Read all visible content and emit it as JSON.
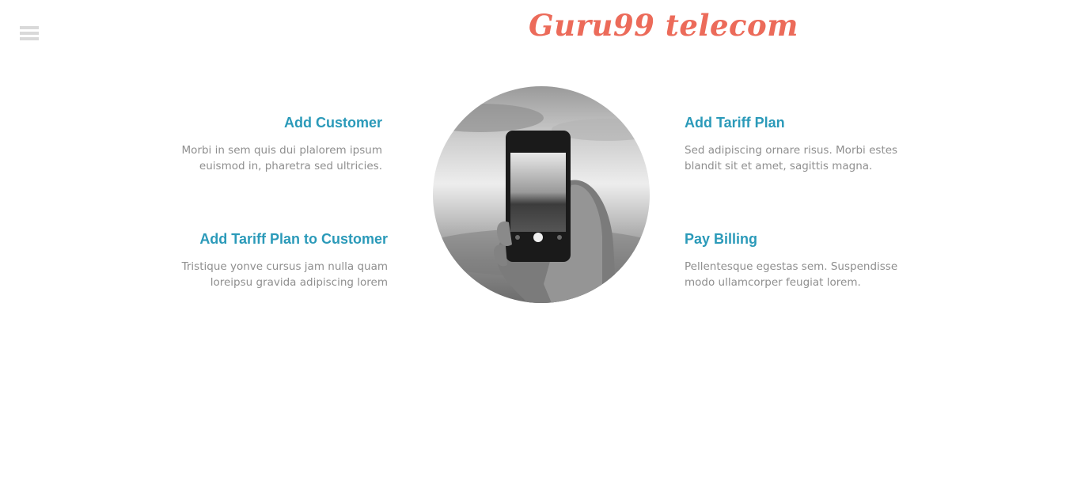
{
  "header": {
    "brand": "Guru99 telecom"
  },
  "menu": {
    "icon": "hamburger-menu-icon"
  },
  "features": {
    "add_customer": {
      "title": "Add Customer",
      "description": "Morbi in sem quis dui plalorem ipsum euismod in, pharetra sed ultricies."
    },
    "add_tariff_plan_to_customer": {
      "title": "Add Tariff Plan to Customer",
      "description": "Tristique yonve cursus jam nulla quam loreipsu gravida adipiscing lorem"
    },
    "add_tariff_plan": {
      "title": "Add Tariff Plan",
      "description": "Sed adipiscing ornare risus. Morbi estes blandit sit et amet, sagittis magna."
    },
    "pay_billing": {
      "title": "Pay Billing",
      "description": "Pellentesque egestas sem. Suspendisse modo ullamcorper feugiat lorem."
    }
  },
  "hero_image": {
    "subject": "hand-holding-smartphone-photo"
  },
  "colors": {
    "brand": "#ec6b5a",
    "feature_title": "#2b9ab9",
    "body_text": "#8f8f8f",
    "menu_icon": "#d9d9d9"
  }
}
